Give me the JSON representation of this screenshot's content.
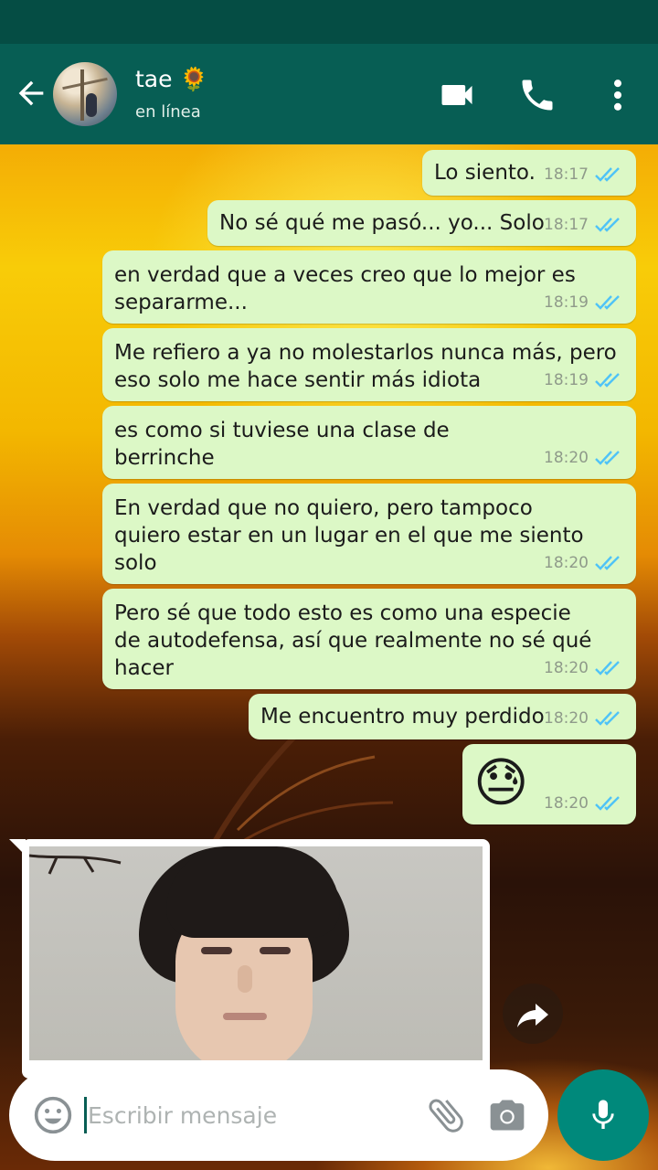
{
  "colors": {
    "header": "#075e54",
    "status_bar": "#054d44",
    "outgoing_bubble": "#dcf8c6",
    "read_ticks": "#4fc3f7",
    "mic_button": "#00897b"
  },
  "header": {
    "back_icon": "arrow-left-icon",
    "contact_name": "tae 🌻",
    "contact_status": "en línea",
    "video_icon": "videocam-icon",
    "call_icon": "phone-icon",
    "menu_icon": "more-vert-icon"
  },
  "messages": [
    {
      "text": "Lo siento.",
      "time": "18:17",
      "status": "read"
    },
    {
      "text": "No sé qué me pasó... yo... Solo",
      "time": "18:17",
      "status": "read"
    },
    {
      "text": "en verdad que a veces creo que lo mejor es\nsepararme...",
      "time": "18:19",
      "status": "read"
    },
    {
      "text": "Me refiero a ya no molestarlos nunca más, pero\neso solo me hace sentir más idiota",
      "time": "18:19",
      "status": "read"
    },
    {
      "text": "es como si tuviese una clase de\nberrinche",
      "time": "18:20",
      "status": "read"
    },
    {
      "text": "En verdad que no quiero, pero tampoco\nquiero estar en un lugar en el que me siento\nsolo",
      "time": "18:20",
      "status": "read"
    },
    {
      "text": "Pero sé que todo esto es como una especie\nde autodefensa, así que realmente no sé qué\nhacer",
      "time": "18:20",
      "status": "read"
    },
    {
      "text": "Me encuentro muy perdido",
      "time": "18:20",
      "status": "read"
    },
    {
      "text": "😓",
      "time": "18:20",
      "status": "read"
    }
  ],
  "incoming_image": {
    "share_icon": "forward-icon"
  },
  "composer": {
    "placeholder": "Escribir mensaje",
    "emoji_icon": "emoji-icon",
    "attach_icon": "paperclip-icon",
    "camera_icon": "camera-icon",
    "mic_icon": "mic-icon"
  }
}
